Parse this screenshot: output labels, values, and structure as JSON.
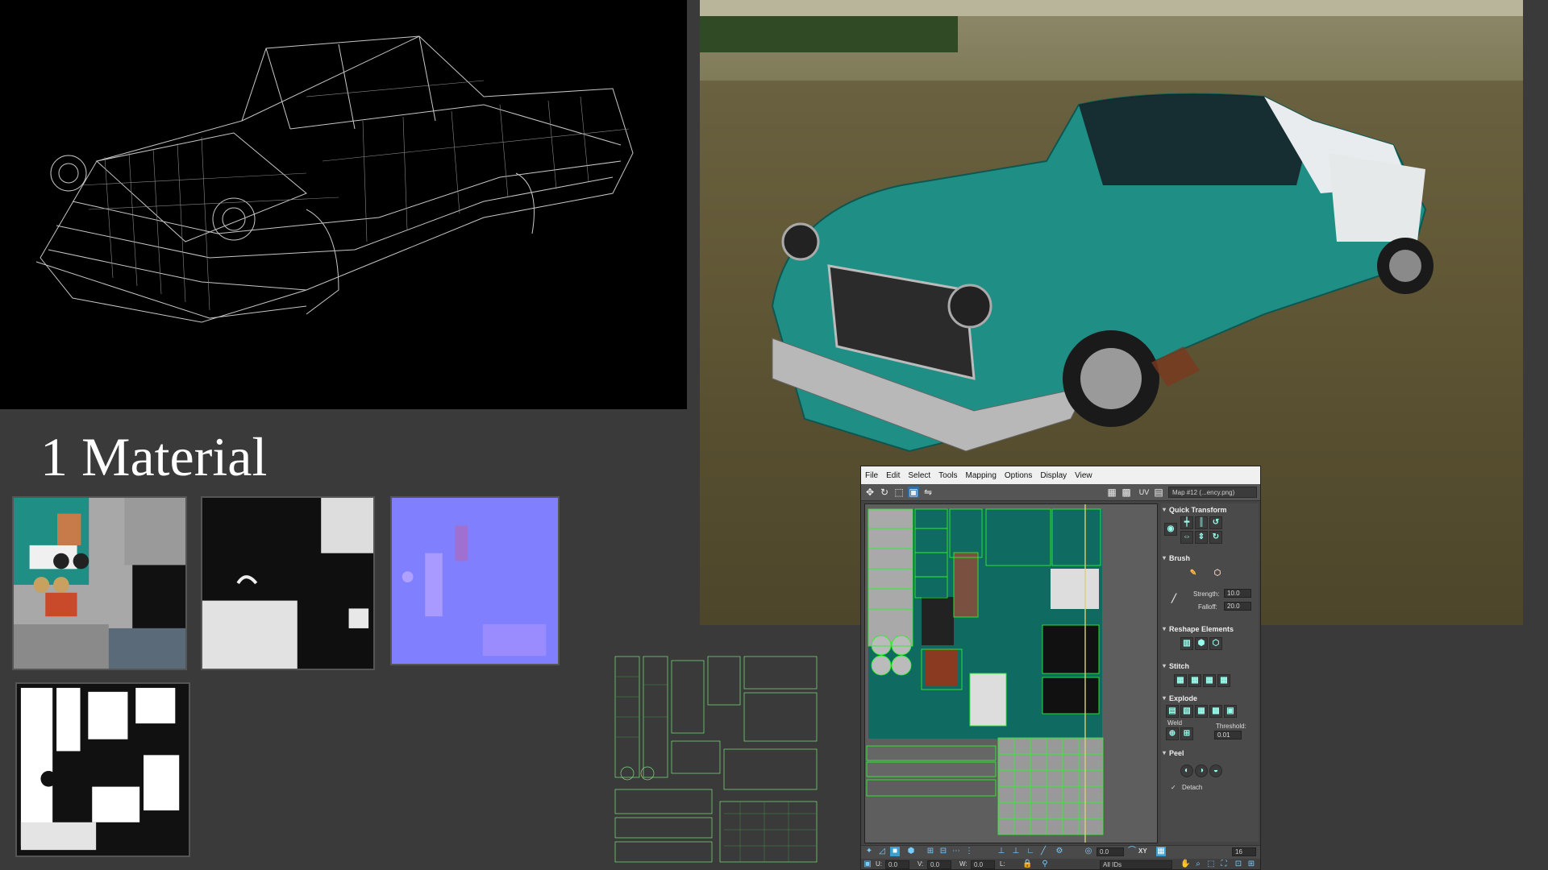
{
  "title": "1 Material",
  "uv_editor": {
    "menu": [
      "File",
      "Edit",
      "Select",
      "Tools",
      "Mapping",
      "Options",
      "Display",
      "View"
    ],
    "toolbar": {
      "uv_label": "UV",
      "map_select": "Map #12 (...ency.png)"
    },
    "panels": {
      "quick_transform": "Quick Transform",
      "brush": "Brush",
      "strength_label": "Strength:",
      "strength_value": "10.0",
      "falloff_label": "Falloff:",
      "falloff_value": "20.0",
      "reshape": "Reshape Elements",
      "stitch": "Stitch",
      "explode": "Explode",
      "weld_label": "Weld",
      "threshold_label": "Threshold:",
      "threshold_value": "0.01",
      "peel": "Peel",
      "detach_label": "Detach"
    },
    "bottom": {
      "u_label": "U:",
      "u_value": "0.0",
      "v_label": "V:",
      "v_value": "0.0",
      "w_label": "W:",
      "w_value": "0.0",
      "l_label": "L:",
      "xy_label": "XY",
      "angle_value": "0.0",
      "grid_value": "16",
      "ids_value": "All IDs"
    }
  },
  "colors": {
    "background": "#3a3a3a",
    "car_teal": "#1f8f86",
    "uv_green": "#35e035",
    "normal_map": "#8080ff"
  }
}
